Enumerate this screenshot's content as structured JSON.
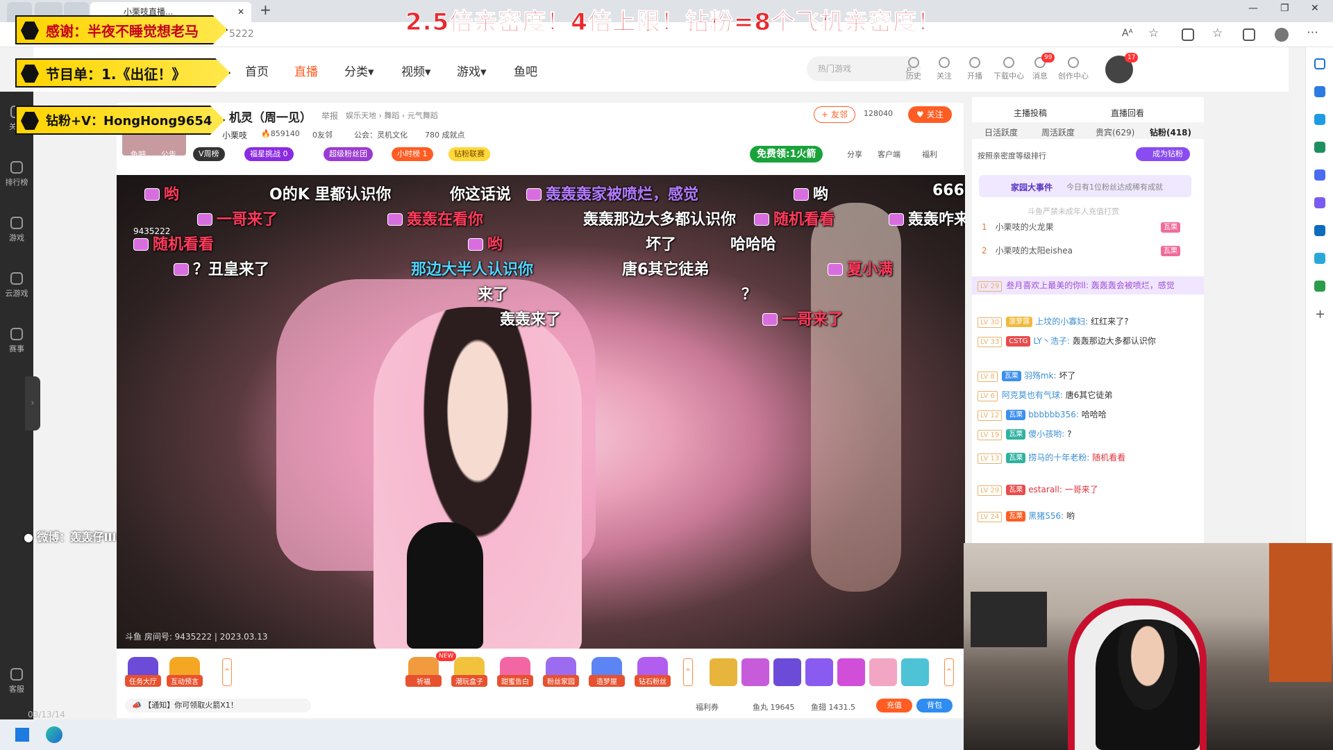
{
  "browser": {
    "tabs": [
      {
        "label": ""
      },
      {
        "label": ""
      },
      {
        "label": ""
      },
      {
        "label": "小栗吱直播..."
      }
    ],
    "address_tail": "5222",
    "new_tab": "+"
  },
  "overlay": {
    "big_title": "2.5倍亲密度！4倍上限！钻粉=8个飞机亲密度！",
    "banner_thanks": "感谢：半夜不睡觉想老马",
    "banner_program": "节目单：1.《出征！》",
    "banner_fan": "钻粉+V：HongHong9654",
    "weibo": "微博：轰轰仔III"
  },
  "header": {
    "nav": [
      "首页",
      "直播",
      "分类",
      "视频",
      "游戏",
      "鱼吧"
    ],
    "active_nav": "直播",
    "search_placeholder": "热门游戏",
    "icons": [
      {
        "label": "历史"
      },
      {
        "label": "关注"
      },
      {
        "label": "开播"
      },
      {
        "label": "下载中心"
      },
      {
        "label": "消息"
      },
      {
        "label": "创作中心"
      }
    ],
    "message_badge": "99",
    "avatar_badge": "17"
  },
  "leftnav": [
    {
      "label": "关注"
    },
    {
      "label": "排行榜"
    },
    {
      "label": "游戏"
    },
    {
      "label": "云游戏"
    },
    {
      "label": "赛事"
    },
    {
      "label": "客服"
    }
  ],
  "room": {
    "title": "机灵（周一见）",
    "report": "举报",
    "category": "娱乐天地 › 舞蹈 › 元气舞蹈",
    "streamer": "小栗吱",
    "heat": "859140",
    "friends": "0友邻",
    "guild": "公会：灵机文化",
    "points": "780 成就点",
    "add_friend": "+ 友邻",
    "followers": "128040",
    "follow": "关注",
    "tags": [
      "V周榜",
      "福星挑战 0",
      "超级粉丝团",
      "小时榜 1",
      "钻粉联赛"
    ],
    "free_rocket": "免费领:1火箭",
    "share": "分享",
    "client": "客户端",
    "welfare": "福利",
    "fish_bar": "鱼吧",
    "notice": "公告",
    "room_number_label": "斗鱼 房间号: 9435222 | 2023.03.13",
    "room_no_overlay": "9435222"
  },
  "danmaku": [
    {
      "text": "哟",
      "color": "dmr",
      "badge": true
    },
    {
      "text": "O的K 里都认识你",
      "color": "dmw",
      "badge": false
    },
    {
      "text": "你这话说",
      "color": "dmw",
      "badge": false
    },
    {
      "text": "轰轰轰家被喷烂，感觉",
      "color": "dmp",
      "badge": true
    },
    {
      "text": "哟",
      "color": "dmw",
      "badge": true
    },
    {
      "text": "666",
      "color": "dmw",
      "badge": false
    },
    {
      "text": "一哥来了",
      "color": "dmr",
      "badge": true
    },
    {
      "text": "轰轰在看你",
      "color": "dmr",
      "badge": true
    },
    {
      "text": "轰轰那边大多都认识你",
      "color": "dmw",
      "badge": false
    },
    {
      "text": "随机看看",
      "color": "dmr",
      "badge": true
    },
    {
      "text": "轰轰咋来",
      "color": "dmw",
      "badge": true
    },
    {
      "text": "随机看看",
      "color": "dmr",
      "badge": true
    },
    {
      "text": "哟",
      "color": "dmr",
      "badge": true
    },
    {
      "text": "坏了",
      "color": "dmw",
      "badge": false
    },
    {
      "text": "哈哈哈",
      "color": "dmw",
      "badge": false
    },
    {
      "text": "？丑皇来了",
      "color": "dmw",
      "badge": true
    },
    {
      "text": "那边大半人认识你",
      "color": "dmc",
      "badge": false
    },
    {
      "text": "唐6其它徒弟",
      "color": "dmw",
      "badge": false
    },
    {
      "text": "夏小满",
      "color": "dmr",
      "badge": true
    },
    {
      "text": "来了",
      "color": "dmw",
      "badge": false
    },
    {
      "text": "？",
      "color": "dmw",
      "badge": false
    },
    {
      "text": "轰轰来了",
      "color": "dmw",
      "badge": false
    },
    {
      "text": "一哥来了",
      "color": "dmr",
      "badge": true
    }
  ],
  "toolbar": {
    "left_tools": [
      "任务大厅",
      "互动预言"
    ],
    "center_tools": [
      "祈福",
      "潮玩盒子",
      "甜蜜告白",
      "粉丝家园",
      "造梦屋",
      "钻石粉丝"
    ],
    "new_badge": "NEW",
    "notice": "【通知】你可领取火箭X1！",
    "welfare_coupon": "福利券",
    "fish_ball": "鱼丸 19645",
    "fish_wing": "鱼翅 1431.5",
    "recharge": "充值",
    "backpack": "背包"
  },
  "rightpanel": {
    "top_tabs": [
      "主播投稿",
      "直播回看"
    ],
    "tabs": [
      "日活跃度",
      "周活跃度",
      "贵宾(629)",
      "钻粉(418)"
    ],
    "rank_hint": "按照亲密度等级排行",
    "become_fan": "成为钻粉",
    "event_title": "家园大事件",
    "event_text": "今日有1位粉丝达成稀有成就",
    "minor_notice": "斗鱼严禁未成年人充值打赏",
    "ranks": [
      {
        "no": "1",
        "name": "小栗吱的火龙果",
        "badge": "瓦栗"
      },
      {
        "no": "2",
        "name": "小栗吱的太阳eishea",
        "badge": "瓦栗"
      }
    ],
    "chat": [
      {
        "lv": "LV 29",
        "name": "叁月喜欢上最美的你ll:",
        "msg": "轰轰轰会被喷烂，感觉",
        "fan": ""
      },
      {
        "lv": "LV 30",
        "name": "上坟的小寡妇:",
        "msg": "红红来了?",
        "fan": "菠萝露"
      },
      {
        "lv": "LV 33",
        "name": "LY丶浩子:",
        "msg": "轰轰那边大多都认识你",
        "fan": "CSTG"
      },
      {
        "lv": "LV 8",
        "name": "羽殇mk:",
        "msg": "坏了",
        "fan": "瓦栗"
      },
      {
        "lv": "LV 6",
        "name": "阿克莫也有气球:",
        "msg": "唐6其它徒弟",
        "fan": ""
      },
      {
        "lv": "LV 12",
        "name": "bbbbbb356:",
        "msg": "哈哈哈",
        "fan": "瓦栗"
      },
      {
        "lv": "LV 19",
        "name": "傻小孩哟:",
        "msg": "?",
        "fan": "瓦栗"
      },
      {
        "lv": "LV 13",
        "name": "捞马的十年老粉:",
        "msg": "随机看看",
        "fan": "瓦栗"
      },
      {
        "lv": "LV 29",
        "name": "estarall:",
        "msg": "一哥来了",
        "fan": "瓦栗"
      },
      {
        "lv": "LV 24",
        "name": "黑猪556:",
        "msg": "哟",
        "fan": "瓦栗"
      }
    ]
  },
  "taskbar": {
    "time": "03/13/14"
  },
  "colors": {
    "accent": "#ff5d23",
    "danmaku_red": "#ff3b5c",
    "banner_yellow": "#ffd400"
  }
}
